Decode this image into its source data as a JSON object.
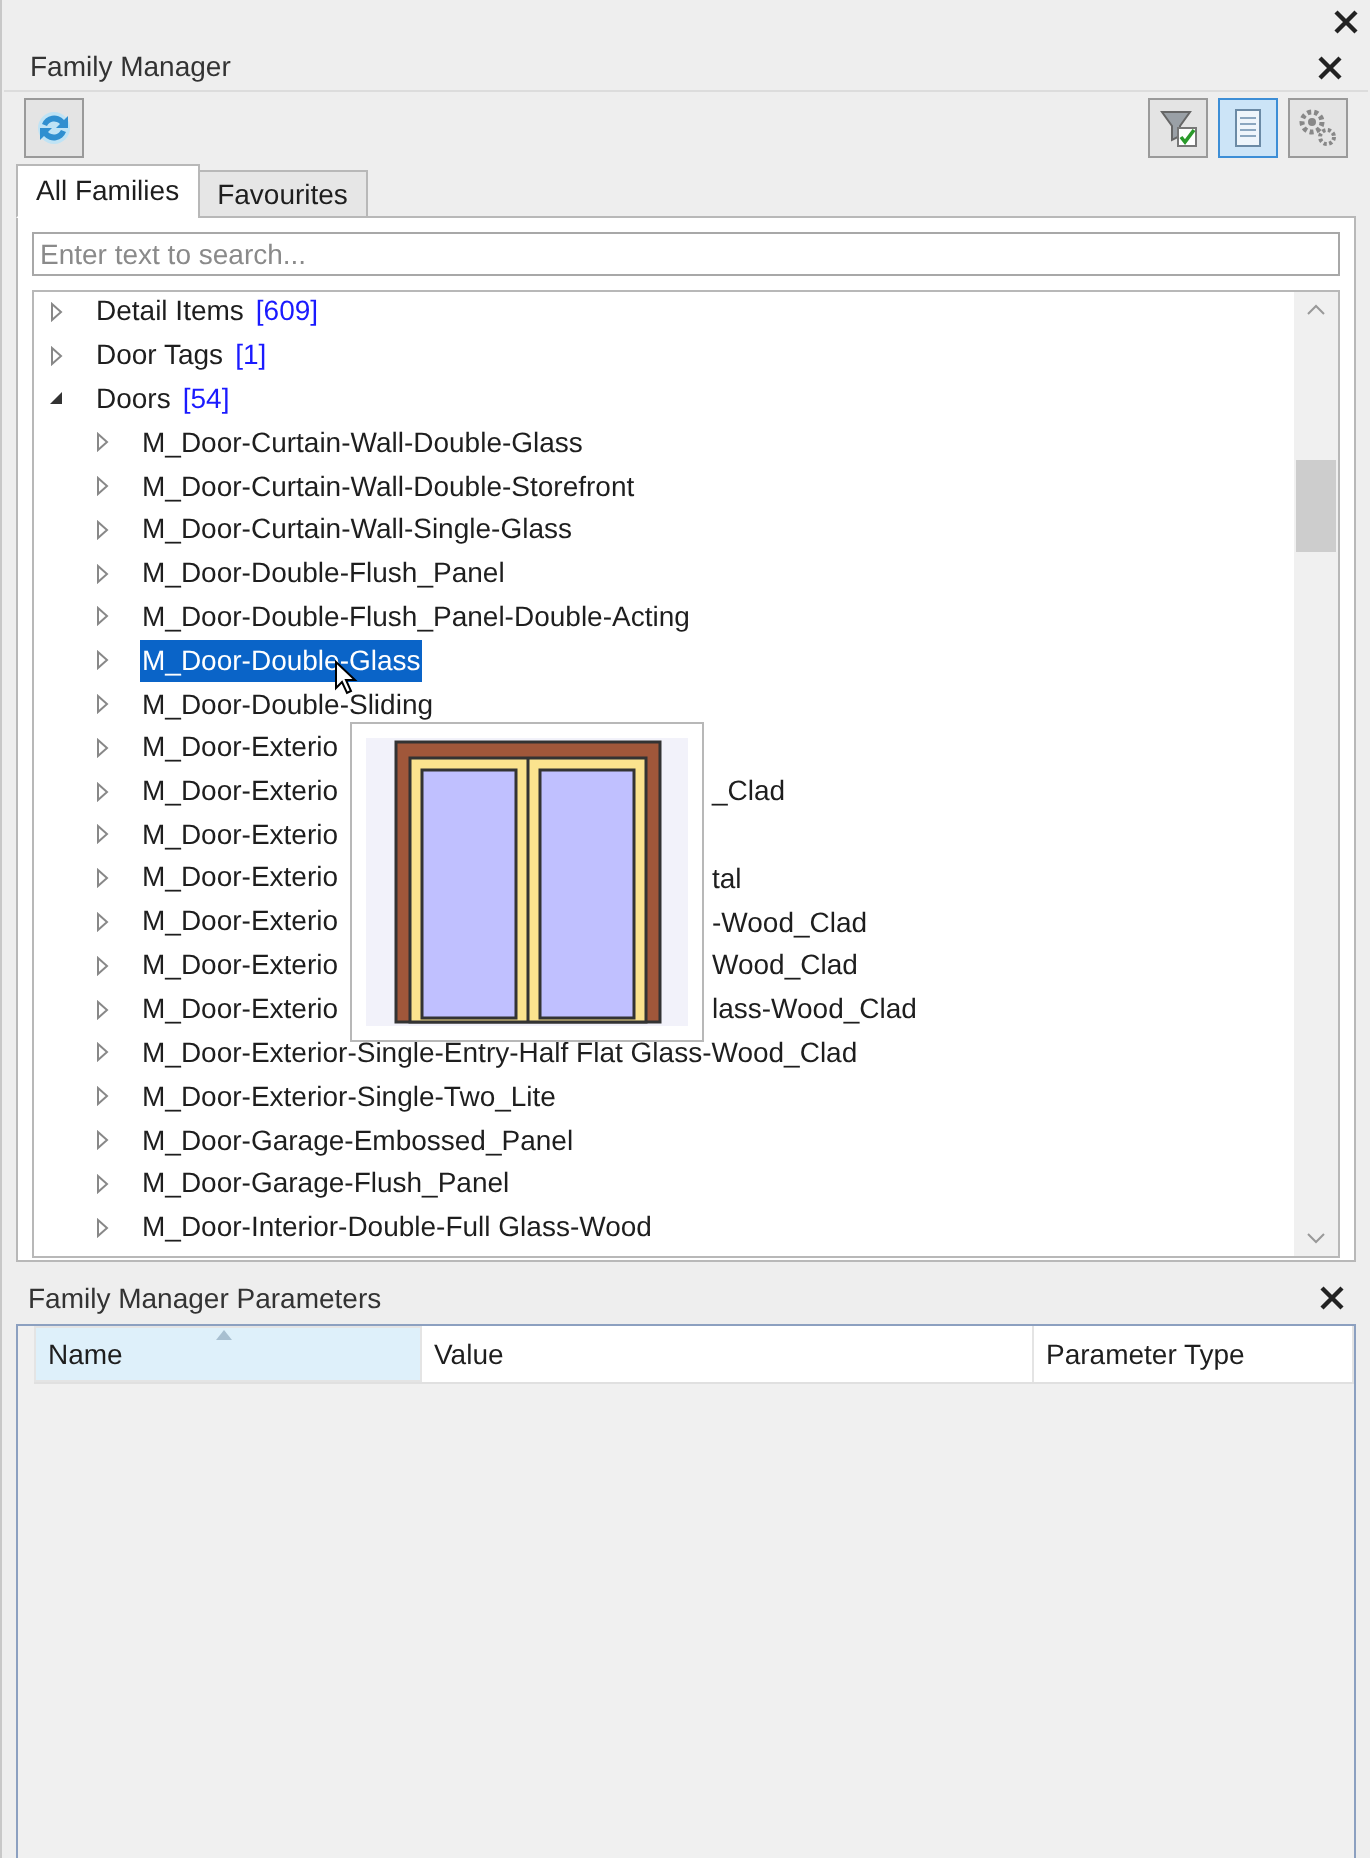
{
  "title": "Family Manager",
  "toolbar": [
    {
      "kind": "refresh",
      "on": false
    },
    {
      "kind": "filter",
      "on": false
    },
    {
      "kind": "table",
      "on": true
    },
    {
      "kind": "settings",
      "on": false
    }
  ],
  "tabs": [
    {
      "label": "All Families",
      "selected": true
    },
    {
      "label": "Favourites",
      "selected": false
    }
  ],
  "search": {
    "placeholder": "Enter text to search..."
  },
  "tree": [
    {
      "label": "Detail Items",
      "count": "[609]",
      "expanded": false,
      "selected": false
    },
    {
      "label": "Door Tags",
      "count": "[1]",
      "expanded": false,
      "selected": false
    },
    {
      "label": "Doors",
      "count": "[54]",
      "expanded": true,
      "selected": false,
      "children": [
        {
          "label": "M_Door-Curtain-Wall-Double-Glass",
          "selected": false
        },
        {
          "label": "M_Door-Curtain-Wall-Double-Storefront",
          "selected": false
        },
        {
          "label": "M_Door-Curtain-Wall-Single-Glass",
          "selected": false
        },
        {
          "label": "M_Door-Double-Flush_Panel",
          "selected": false
        },
        {
          "label": "M_Door-Double-Flush_Panel-Double-Acting",
          "selected": false
        },
        {
          "label": "M_Door-Double-Glass",
          "selected": true
        },
        {
          "label": "M_Door-Double-Sliding",
          "selected": false
        },
        {
          "label": "M_Door-Exterio",
          "selected": false
        },
        {
          "label": "M_Door-Exterio",
          "tail": "_Clad",
          "selected": false
        },
        {
          "label": "M_Door-Exterio",
          "selected": false
        },
        {
          "label": "M_Door-Exterio",
          "tail": "tal",
          "selected": false
        },
        {
          "label": "M_Door-Exterio",
          "tail": "-Wood_Clad",
          "selected": false
        },
        {
          "label": "M_Door-Exterio",
          "tail": "Wood_Clad",
          "selected": false
        },
        {
          "label": "M_Door-Exterio",
          "tail": "lass-Wood_Clad",
          "selected": false
        },
        {
          "label": "M_Door-Exterior-Single-Entry-Half Flat Glass-Wood_Clad",
          "selected": false
        },
        {
          "label": "M_Door-Exterior-Single-Two_Lite",
          "selected": false
        },
        {
          "label": "M_Door-Garage-Embossed_Panel",
          "selected": false
        },
        {
          "label": "M_Door-Garage-Flush_Panel",
          "selected": false
        },
        {
          "label": "M_Door-Interior-Double-Full Glass-Wood",
          "selected": false
        }
      ]
    }
  ],
  "parameters": {
    "title": "Family Manager Parameters",
    "columns": [
      {
        "label": "Name",
        "sorted": true
      },
      {
        "label": "Value",
        "sorted": false
      },
      {
        "label": "Parameter Type",
        "sorted": false
      }
    ]
  }
}
